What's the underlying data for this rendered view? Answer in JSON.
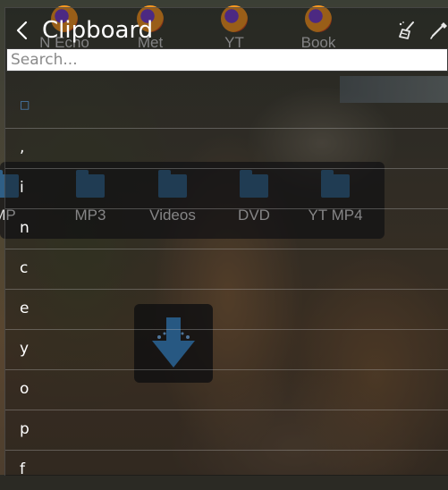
{
  "clipboard": {
    "title": "Clipboard",
    "search_placeholder": "Search...",
    "items": [
      {
        "text": "□"
      },
      {
        "text": ","
      },
      {
        "text": "i"
      },
      {
        "text": "n"
      },
      {
        "text": "c"
      },
      {
        "text": "e"
      },
      {
        "text": "y"
      },
      {
        "text": "o"
      },
      {
        "text": "p"
      },
      {
        "text": "f"
      }
    ]
  },
  "desktop": {
    "top_icons": [
      {
        "label": "N Echo",
        "icon": "firefox-icon"
      },
      {
        "label": "Met",
        "icon": "firefox-icon"
      },
      {
        "label": "YT",
        "icon": "firefox-icon"
      },
      {
        "label": "Book",
        "icon": "firefox-icon"
      }
    ],
    "folders": [
      {
        "label": "MP"
      },
      {
        "label": "MP3"
      },
      {
        "label": "Videos"
      },
      {
        "label": "DVD"
      },
      {
        "label": "YT MP4"
      }
    ]
  },
  "colors": {
    "selected_item": "#4f8fd0",
    "folder": "#2f5f86",
    "download_arrow": "#3c8fd6"
  }
}
